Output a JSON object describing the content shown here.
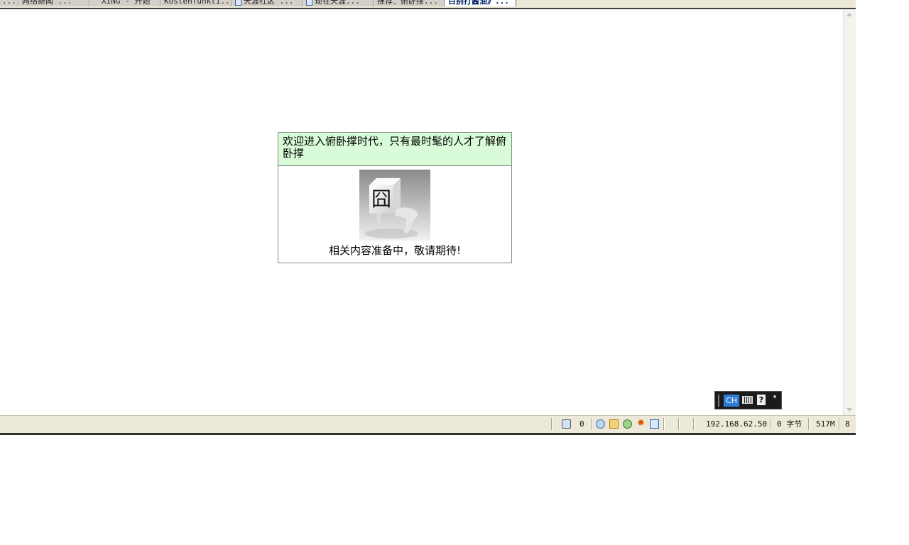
{
  "tabs": [
    {
      "label": "..."
    },
    {
      "label": "网络新闻 ..."
    },
    {
      "label": "XING - 开始"
    },
    {
      "label": "Kostenfunkti..."
    },
    {
      "label": "天涯社区 ..."
    },
    {
      "label": "现在天涯..."
    },
    {
      "label": "推荐：俯卧撑..."
    },
    {
      "label": "百别打酱油》..."
    }
  ],
  "content": {
    "header_text": "欢迎进入俯卧撑时代，只有最时髦的人才了解俯卧撑",
    "caption": "相关内容准备中，敬请期待!"
  },
  "language_bar": {
    "lang": "CH",
    "help": "?",
    "menu": "▾"
  },
  "status_bar": {
    "count": "0",
    "ip": "192.168.62.50",
    "bytes": "0 字节",
    "memory": "517M",
    "extra": "8"
  }
}
